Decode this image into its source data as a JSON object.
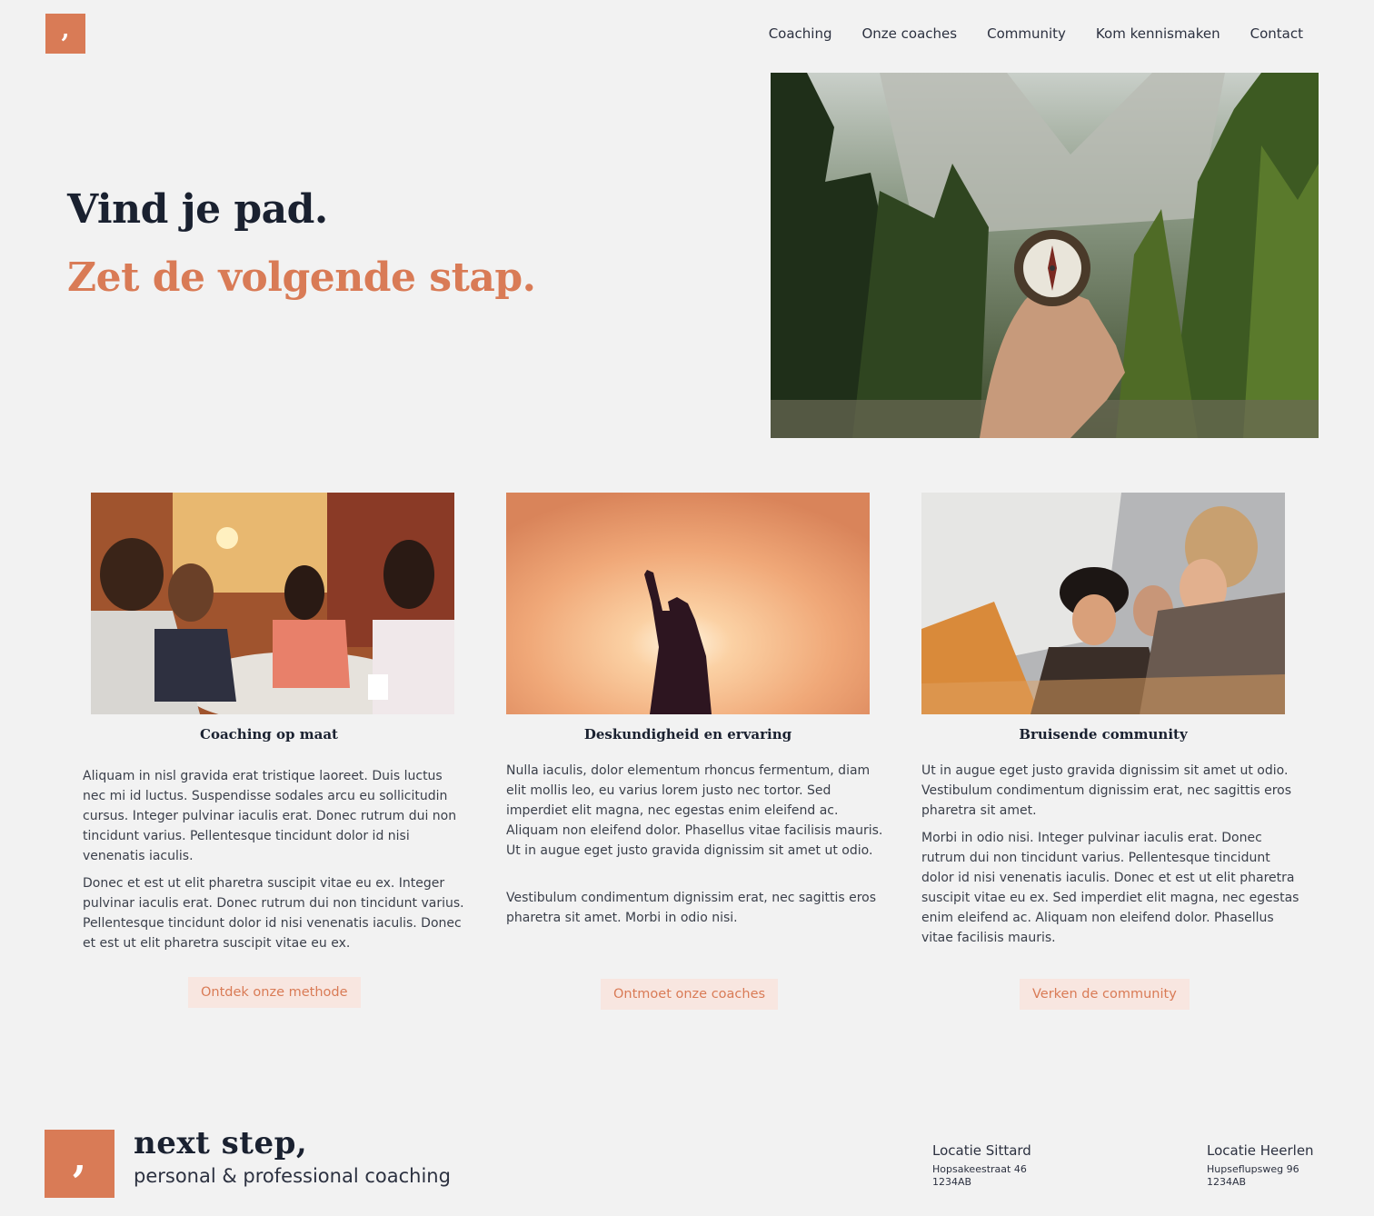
{
  "header": {
    "logo_mark": ",",
    "nav": [
      "Coaching",
      "Onze coaches",
      "Community",
      "Kom kennismaken",
      "Contact"
    ]
  },
  "hero": {
    "title": "Vind je pad.",
    "subtitle": "Zet de volgende stap."
  },
  "cards": [
    {
      "title": "Coaching op maat",
      "paragraphs": [
        "Aliquam in nisl gravida erat tristique laoreet. Duis luctus nec mi id luctus. Suspendisse sodales arcu eu sollicitudin cursus. Integer pulvinar iaculis erat. Donec rutrum dui non tincidunt varius. Pellentesque tincidunt dolor id nisi venenatis iaculis.",
        "Donec et est ut elit pharetra suscipit vitae eu ex. Integer pulvinar iaculis erat. Donec rutrum dui non tincidunt varius. Pellentesque tincidunt dolor id nisi venenatis iaculis. Donec et est ut elit pharetra suscipit vitae eu ex."
      ],
      "button": "Ontdek onze methode"
    },
    {
      "title": "Deskundigheid en ervaring",
      "paragraphs": [
        "Nulla iaculis, dolor elementum rhoncus fermentum, diam elit mollis leo, eu varius lorem justo nec tortor. Sed imperdiet elit magna, nec egestas enim eleifend ac. Aliquam non eleifend dolor. Phasellus vitae facilisis mauris. Ut in augue eget justo gravida dignissim sit amet ut odio.",
        "Vestibulum condimentum dignissim erat, nec sagittis eros pharetra sit amet. Morbi in odio nisi."
      ],
      "button": "Ontmoet onze coaches"
    },
    {
      "title": "Bruisende community",
      "paragraphs": [
        "Ut in augue eget justo gravida dignissim sit amet ut odio. Vestibulum condimentum dignissim erat, nec sagittis eros pharetra sit amet.",
        "Morbi in odio nisi. Integer pulvinar iaculis erat. Donec rutrum dui non tincidunt varius. Pellentesque tincidunt dolor id nisi venenatis iaculis. Donec et est ut elit pharetra suscipit vitae eu ex. Sed imperdiet elit magna, nec egestas enim eleifend ac. Aliquam non eleifend dolor. Phasellus vitae facilisis mauris."
      ],
      "button": "Verken de community"
    }
  ],
  "footer": {
    "logo_mark": ",",
    "brand": "next step,",
    "tagline": "personal & professional coaching",
    "locations": [
      {
        "title": "Locatie Sittard",
        "street": "Hopsakeestraat 46",
        "zip": "1234AB"
      },
      {
        "title": "Locatie Heerlen",
        "street": "Hupseflupsweg 96",
        "zip": "1234AB"
      }
    ]
  },
  "colors": {
    "accent": "#d97b56",
    "background": "#f2f2f2",
    "heading": "#1a2130",
    "button_bg": "#f8e6e0"
  }
}
